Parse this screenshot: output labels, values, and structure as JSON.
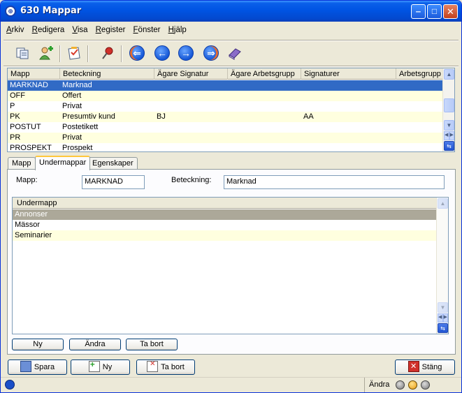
{
  "window": {
    "title": "630 Mappar"
  },
  "menu": [
    "Arkiv",
    "Redigera",
    "Visa",
    "Register",
    "Fönster",
    "Hjälp"
  ],
  "toolbar_icons": [
    "copy-folders-icon",
    "add-user-icon",
    "checklist-icon",
    "pin-icon",
    "first-record-icon",
    "previous-record-icon",
    "next-record-icon",
    "last-record-icon",
    "book-icon"
  ],
  "grid": {
    "columns": [
      "Mapp",
      "Beteckning",
      "Ägare Signatur",
      "Ägare Arbetsgrupp",
      "Signaturer",
      "Arbetsgrupp"
    ],
    "rows": [
      [
        "MARKNAD",
        "Marknad",
        "",
        "",
        "",
        ""
      ],
      [
        "OFF",
        "Offert",
        "",
        "",
        "",
        ""
      ],
      [
        "P",
        "Privat",
        "",
        "",
        "",
        ""
      ],
      [
        "PK",
        "Presumtiv kund",
        "BJ",
        "",
        "AA",
        ""
      ],
      [
        "POSTUT",
        "Postetikett",
        "",
        "",
        "",
        ""
      ],
      [
        "PR",
        "Privat",
        "",
        "",
        "",
        ""
      ],
      [
        "PROSPEKT",
        "Prospekt",
        "",
        "",
        "",
        ""
      ]
    ],
    "selected_row": 0
  },
  "tabs": [
    "Mapp",
    "Undermappar",
    "Egenskaper"
  ],
  "active_tab": 1,
  "form": {
    "mapp_label": "Mapp:",
    "mapp_value": "MARKNAD",
    "beteckning_label": "Beteckning:",
    "beteckning_value": "Marknad"
  },
  "subgrid": {
    "column": "Undermapp",
    "rows": [
      "Annonser",
      "Mässor",
      "Seminarier"
    ],
    "selected_row": 0
  },
  "sub_buttons": {
    "new": "Ny",
    "edit": "Ändra",
    "delete": "Ta bort"
  },
  "bottom_buttons": {
    "save": "Spara",
    "new": "Ny",
    "delete": "Ta bort",
    "close": "Stäng"
  },
  "status": {
    "mode": "Ändra"
  },
  "colors": {
    "title_bar": "#0054e3",
    "selection": "#316ac5",
    "alt_row": "#ffffdf",
    "sub_selection": "#aca899"
  }
}
